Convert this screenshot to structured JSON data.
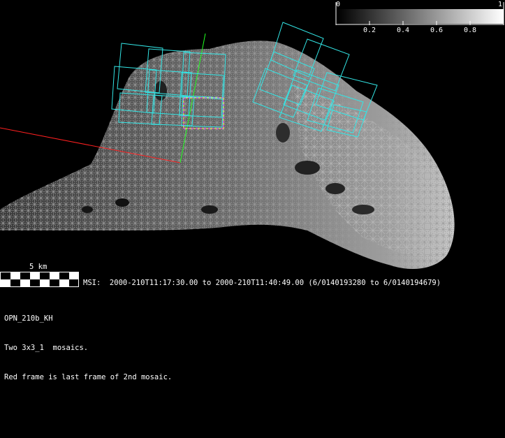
{
  "colorbar": {
    "min_label": "0",
    "max_label": "1",
    "tick_labels": [
      "0.2",
      "0.4",
      "0.6",
      "0.8"
    ]
  },
  "scale": {
    "label": "5 km"
  },
  "msi": {
    "text": "MSI:  2000-210T11:17:30.00 to 2000-210T11:40:49.00 (6/0140193280 to 6/0140194679)"
  },
  "info": {
    "line1": "OPN_210b_KH",
    "line2": "Two 3x3_1  mosaics.",
    "line3": "Red frame is last frame of 2nd mosaic."
  },
  "colors": {
    "background": "#000000",
    "frame_outline": "#33e6e6",
    "axis_x": "#ff2020",
    "axis_y": "#20ff20",
    "dashed_frame": "#ff40ff",
    "dashed_frame_alt": "#ffff40"
  }
}
